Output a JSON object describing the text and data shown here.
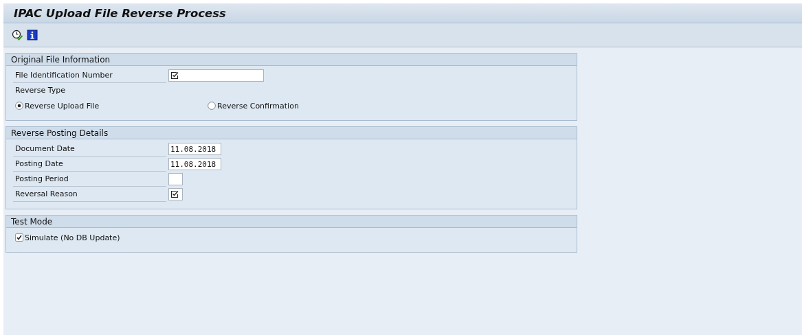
{
  "window": {
    "title": "IPAC Upload File Reverse Process"
  },
  "groups": [
    {
      "title": "Original File Information",
      "rows": [
        {
          "kind": "text_field",
          "label": "File Identification Number",
          "value": "",
          "required": true
        },
        {
          "kind": "label",
          "label": "Reverse Type"
        },
        {
          "kind": "radios",
          "options": [
            {
              "label": "Reverse Upload File",
              "selected": true
            },
            {
              "label": "Reverse Confirmation",
              "selected": false
            }
          ]
        }
      ]
    },
    {
      "title": "Reverse Posting Details",
      "rows": [
        {
          "kind": "date_field",
          "label": "Document Date",
          "value": "11.08.2018",
          "required": false
        },
        {
          "kind": "date_field",
          "label": "Posting Date",
          "value": "11.08.2018",
          "required": false
        },
        {
          "kind": "code_field",
          "label": "Posting Period",
          "value": "",
          "required": false
        },
        {
          "kind": "code_field",
          "label": "Reversal Reason",
          "value": "",
          "required": true
        }
      ]
    },
    {
      "title": "Test Mode",
      "rows": [
        {
          "kind": "checkbox",
          "label": "Simulate (No DB Update)",
          "checked": true
        }
      ]
    }
  ]
}
